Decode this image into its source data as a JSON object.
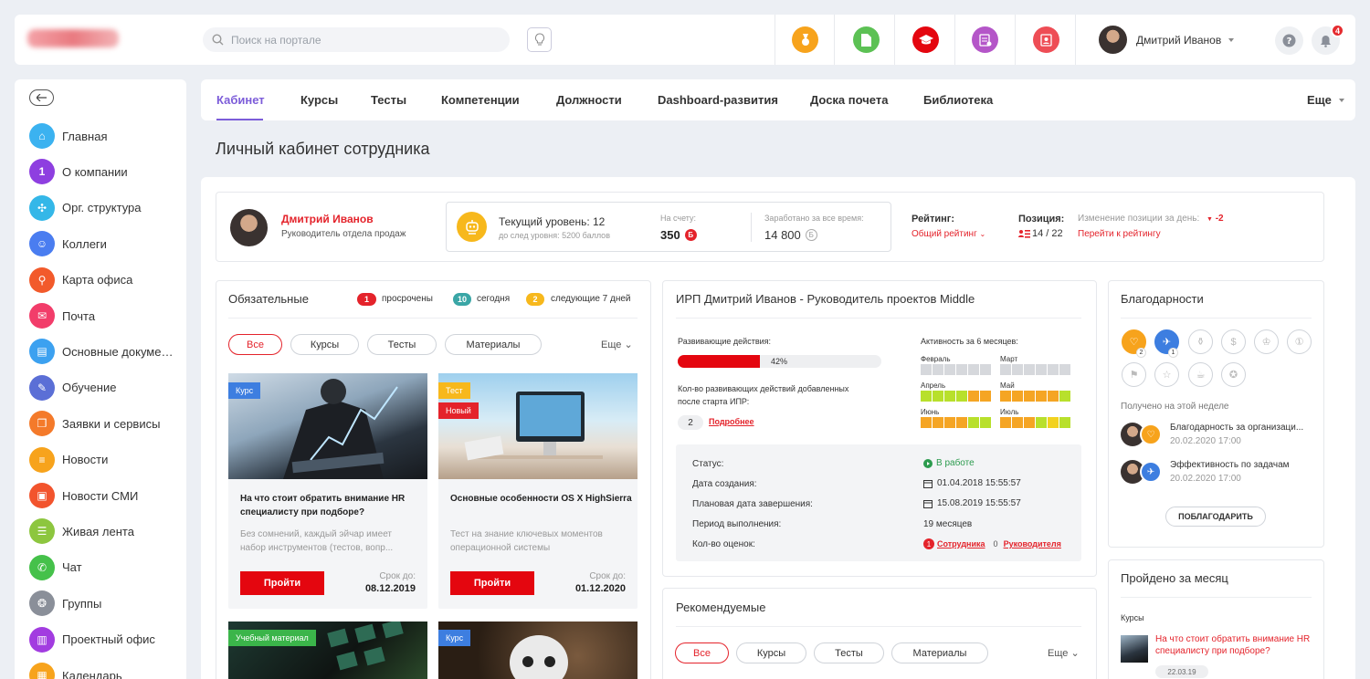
{
  "header": {
    "search_placeholder": "Поиск на портале",
    "user_name": "Дмитрий Иванов",
    "notifications_count": "4",
    "top_icons": [
      {
        "name": "medal-icon",
        "color": "#f7a31c"
      },
      {
        "name": "document-icon",
        "color": "#5cc154"
      },
      {
        "name": "graduation-cap-icon",
        "color": "#e4060f"
      },
      {
        "name": "report-icon",
        "color": "#b456c8"
      },
      {
        "name": "contact-card-icon",
        "color": "#ee4d55"
      }
    ]
  },
  "sidebar": {
    "items": [
      {
        "label": "Главная",
        "icon": "home-icon",
        "color": "#3bb2f0",
        "glyph": "⌂"
      },
      {
        "label": "О компании",
        "icon": "about-icon",
        "color": "#8e3fe0",
        "glyph": "1"
      },
      {
        "label": "Орг. структура",
        "icon": "org-structure-icon",
        "color": "#34b7e8",
        "glyph": "✣"
      },
      {
        "label": "Коллеги",
        "icon": "colleagues-icon",
        "color": "#4a7df0",
        "glyph": "☺"
      },
      {
        "label": "Карта офиса",
        "icon": "office-map-icon",
        "color": "#f25a2b",
        "glyph": "⚲"
      },
      {
        "label": "Почта",
        "icon": "mail-icon",
        "color": "#f23d6a",
        "glyph": "✉"
      },
      {
        "label": "Основные документы",
        "icon": "documents-icon",
        "color": "#3ca1f0",
        "glyph": "▤"
      },
      {
        "label": "Обучение",
        "icon": "education-icon",
        "color": "#5b6fd6",
        "glyph": "✎"
      },
      {
        "label": "Заявки и сервисы",
        "icon": "requests-icon",
        "color": "#f47a2a",
        "glyph": "❐"
      },
      {
        "label": "Новости",
        "icon": "news-icon",
        "color": "#f7a31c",
        "glyph": "≡"
      },
      {
        "label": "Новости СМИ",
        "icon": "media-news-icon",
        "color": "#f2542d",
        "glyph": "▣"
      },
      {
        "label": "Живая лента",
        "icon": "feed-icon",
        "color": "#8dc63f",
        "glyph": "☰"
      },
      {
        "label": "Чат",
        "icon": "chat-icon",
        "color": "#45c14a",
        "glyph": "✆"
      },
      {
        "label": "Группы",
        "icon": "groups-icon",
        "color": "#8a8f99",
        "glyph": "❂"
      },
      {
        "label": "Проектный офис",
        "icon": "project-office-icon",
        "color": "#a23ce0",
        "glyph": "▥"
      },
      {
        "label": "Календарь",
        "icon": "calendar-icon",
        "color": "#f7a31c",
        "glyph": "▦"
      }
    ]
  },
  "tabs": [
    "Кабинет",
    "Курсы",
    "Тесты",
    "Компетенции",
    "Должности",
    "Dashboard-развития",
    "Доска почета",
    "Библиотека"
  ],
  "tabs_more": "Еще",
  "page_title": "Личный кабинет сотрудника",
  "profile": {
    "name": "Дмитрий Иванов",
    "position": "Руководитель отдела продаж",
    "level_label": "Текущий уровень: 12",
    "level_next": "до след уровня: 5200 баллов",
    "balance_label": "На счету:",
    "balance_value": "350",
    "earned_label": "Заработано за все время:",
    "earned_value": "14 800",
    "rating_label": "Рейтинг:",
    "rating_value": "Общий рейтинг",
    "position_label": "Позиция:",
    "position_value": "14 / 22",
    "change_label": "Изменение позиции за день:",
    "change_value": "-2",
    "rating_link": "Перейти к рейтингу"
  },
  "mandatory": {
    "title": "Обязательные",
    "counters": [
      {
        "count": "1",
        "label": "просрочены",
        "color": "#e4232b"
      },
      {
        "count": "10",
        "label": "сегодня",
        "color": "#3aa6a6"
      },
      {
        "count": "2",
        "label": "следующие 7 дней",
        "color": "#f7b81c"
      }
    ],
    "filters": [
      "Все",
      "Курсы",
      "Тесты",
      "Материалы"
    ],
    "more": "Еще",
    "cards": [
      {
        "tag": "Курс",
        "title": "На что стоит обратить внимание HR специалисту при подборе?",
        "desc": "Без сомнений, каждый эйчар имеет набор инструментов (тестов, вопр...",
        "button": "Пройти",
        "deadline_label": "Срок до:",
        "deadline": "08.12.2019"
      },
      {
        "tag": "Тест",
        "tag2": "Новый",
        "title": "Основные особенности OS X HighSierra",
        "desc": "Тест на знание ключевых моментов операционной системы",
        "button": "Пройти",
        "deadline_label": "Срок до:",
        "deadline": "01.12.2020"
      }
    ],
    "bottom_tags": [
      "Учебный материал",
      "Курс"
    ]
  },
  "ipr": {
    "title": "ИРП Дмитрий Иванов - Руководитель проектов Middle",
    "dev_label": "Развивающие действия:",
    "progress": 42,
    "progress_text": "42%",
    "added_label": "Кол-во развивающих действий добавленных после старта ИПР:",
    "added_count": "2",
    "details_link": "Подробнее",
    "activity_label": "Активность за 6 месяцев:",
    "months": [
      "Февраль",
      "Март",
      "Апрель",
      "Май",
      "Июнь",
      "Июль"
    ],
    "status": {
      "status_label": "Статус:",
      "status_value": "В работе",
      "created_label": "Дата создания:",
      "created_value": "01.04.2018 15:55:57",
      "planned_label": "Плановая дата завершения:",
      "planned_value": "15.08.2019 15:55:57",
      "period_label": "Период выполнения:",
      "period_value": "19 месяцев",
      "ratings_label": "Кол-во оценок:",
      "rating_emp_count": "1",
      "rating_emp": "Сотрудника",
      "rating_mgr_count": "0",
      "rating_mgr": "Руководителя"
    }
  },
  "recommended": {
    "title": "Рекомендуемые",
    "filters": [
      "Все",
      "Курсы",
      "Тесты",
      "Материалы"
    ],
    "more": "Еще"
  },
  "thanks": {
    "title": "Благодарности",
    "badge_counts": [
      "2",
      "1"
    ],
    "week_label": "Получено на этой неделе",
    "items": [
      {
        "title": "Благодарность за организаци...",
        "date": "20.02.2020 17:00"
      },
      {
        "title": "Эффективность по задачам",
        "date": "20.02.2020 17:00"
      }
    ],
    "button": "ПОБЛАГОДАРИТЬ"
  },
  "monthly": {
    "title": "Пройдено за месяц",
    "category": "Курсы",
    "item_title": "На что стоит обратить внимание HR специалисту при подборе?",
    "item_date": "22.03.19"
  }
}
